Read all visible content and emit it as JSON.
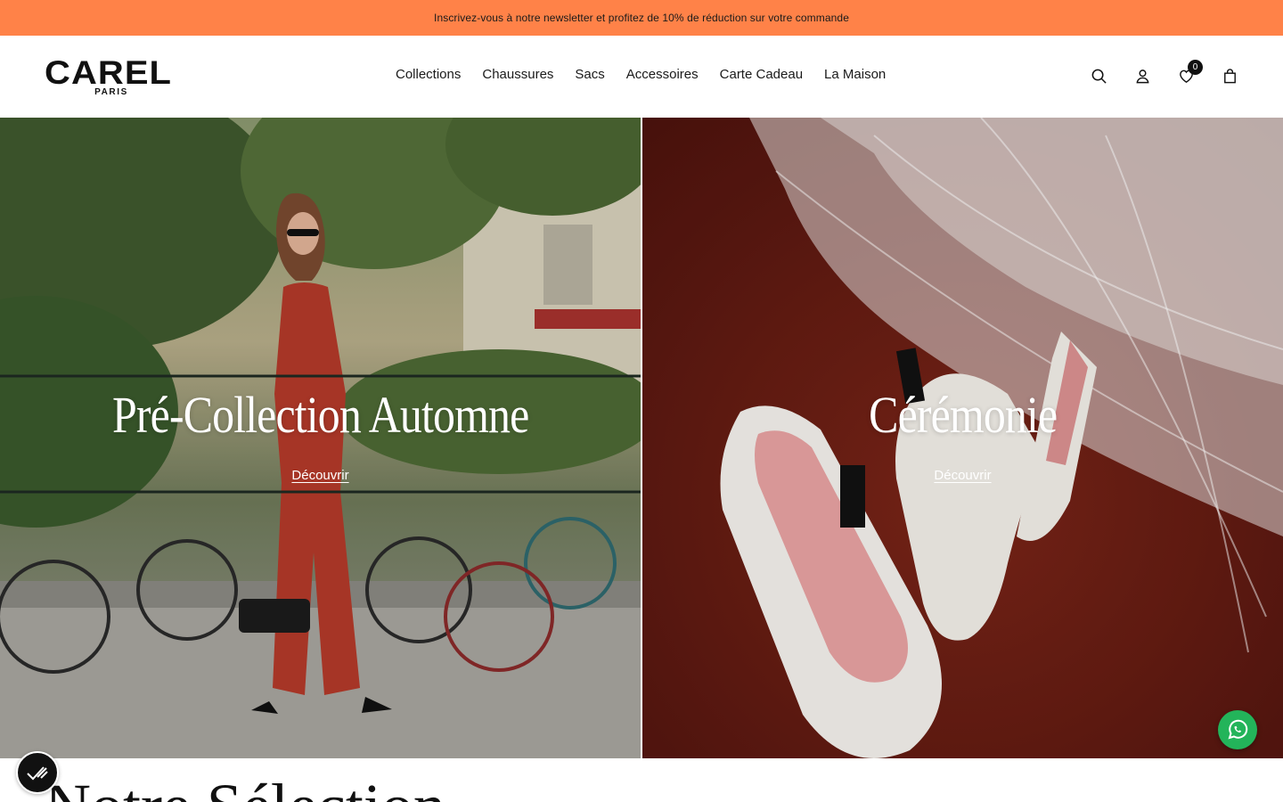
{
  "announcement": {
    "text": "Inscrivez-vous à notre newsletter et profitez de 10% de réduction sur votre commande"
  },
  "brand": {
    "name": "CAREL",
    "sub": "PARIS"
  },
  "nav": {
    "items": [
      {
        "label": "Collections"
      },
      {
        "label": "Chaussures"
      },
      {
        "label": "Sacs"
      },
      {
        "label": "Accessoires"
      },
      {
        "label": "Carte Cadeau"
      },
      {
        "label": "La Maison"
      }
    ]
  },
  "header_icons": {
    "search": "search-icon",
    "account": "user-icon",
    "wishlist": "heart-icon",
    "wishlist_count": "0",
    "cart": "bag-icon"
  },
  "hero": {
    "left": {
      "title": "Pré-Collection Automne",
      "cta": "Découvrir"
    },
    "right": {
      "title": "Cérémonie",
      "cta": "Découvrir"
    }
  },
  "section": {
    "title_partial": "Notre Sélection"
  },
  "floating": {
    "cookie": "cookie-consent-icon",
    "chat": "whatsapp-icon"
  },
  "colors": {
    "announcement_bg": "#ff8248",
    "whatsapp": "#23b45a"
  }
}
